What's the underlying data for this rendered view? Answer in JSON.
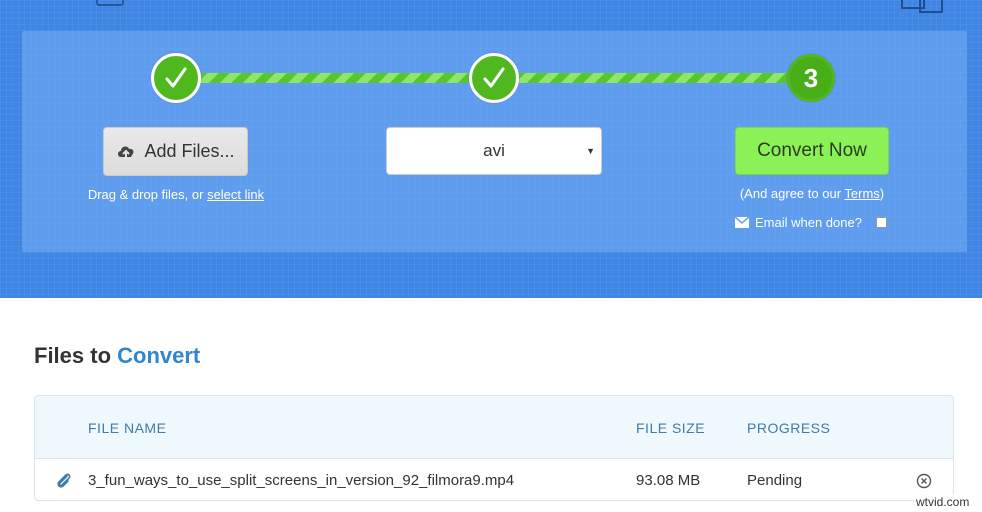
{
  "steps": {
    "step3_label": "3"
  },
  "upload": {
    "add_files_label": "Add Files...",
    "drag_text": "Drag & drop files, or ",
    "select_link_label": "select link"
  },
  "format": {
    "selected": "avi"
  },
  "convert": {
    "button_label": "Convert Now",
    "agree_prefix": "(And agree to our ",
    "terms_label": "Terms",
    "agree_suffix": ")",
    "email_label": "Email when done?"
  },
  "files_section": {
    "title_part1": "Files to ",
    "title_part2": "Convert",
    "columns": {
      "name": "FILE NAME",
      "size": "FILE SIZE",
      "progress": "PROGRESS"
    },
    "rows": [
      {
        "name": "3_fun_ways_to_use_split_screens_in_version_92_filmora9.mp4",
        "size": "93.08 MB",
        "progress": "Pending"
      }
    ]
  },
  "watermark": "wtvid.com",
  "colors": {
    "hero_bg": "#3f86e4",
    "step_green": "#4fb81f",
    "convert_green": "#8af257",
    "accent_blue": "#2f86cf"
  },
  "icons": {
    "step1": "check-icon",
    "step2": "check-icon",
    "add_files": "cloud-upload-icon",
    "format_caret": "caret-down-icon",
    "email": "envelope-icon",
    "file_row": "paperclip-icon",
    "remove": "close-circle-icon"
  }
}
